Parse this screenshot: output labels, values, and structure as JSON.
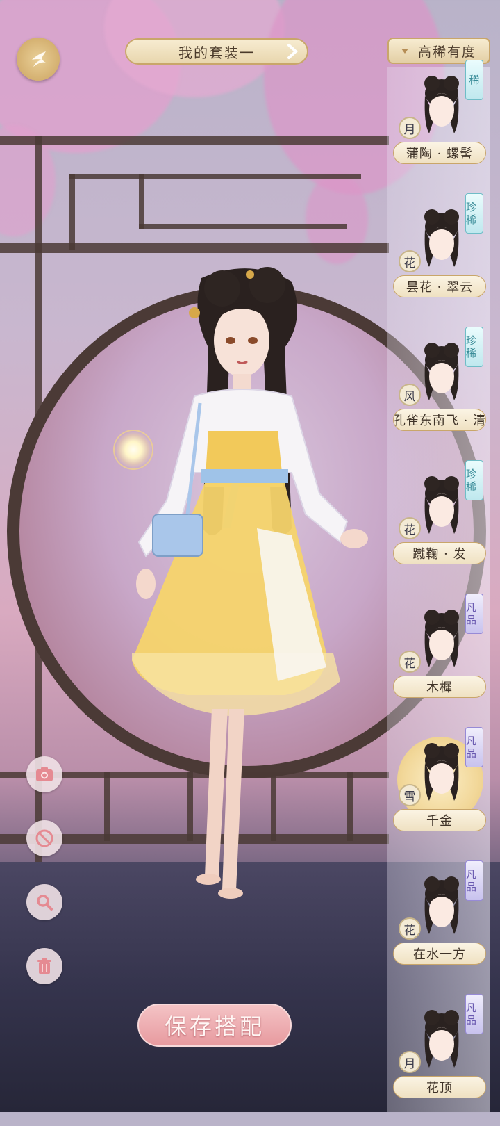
{
  "header": {
    "back_icon": "swallow-back-icon",
    "outfit_name": "我的套装一",
    "sort_label": "高稀有度"
  },
  "items": [
    {
      "name": "蒲陶 · 螺髻",
      "element": "月",
      "rarity": "稀",
      "rarity_tier": "zhen",
      "selected": false
    },
    {
      "name": "昙花 · 翠云",
      "element": "花",
      "rarity": "珍稀",
      "rarity_tier": "zhen",
      "selected": false
    },
    {
      "name": "孔雀东南飞 · 清",
      "element": "风",
      "rarity": "珍稀",
      "rarity_tier": "zhen",
      "selected": false
    },
    {
      "name": "蹴鞠 · 发",
      "element": "花",
      "rarity": "珍稀",
      "rarity_tier": "zhen",
      "selected": false
    },
    {
      "name": "木樨",
      "element": "花",
      "rarity": "凡品",
      "rarity_tier": "feng",
      "selected": false
    },
    {
      "name": "千金",
      "element": "雪",
      "rarity": "凡品",
      "rarity_tier": "feng",
      "selected": true
    },
    {
      "name": "在水一方",
      "element": "花",
      "rarity": "凡品",
      "rarity_tier": "feng",
      "selected": false
    },
    {
      "name": "花顶",
      "element": "月",
      "rarity": "凡品",
      "rarity_tier": "feng",
      "selected": false
    }
  ],
  "tools": [
    "camera-icon",
    "no-entry-icon",
    "magnifier-icon",
    "trash-icon"
  ],
  "save_label": "保存搭配",
  "colors": {
    "accent_gold": "#d4b070",
    "save_pink": "#e79a9f",
    "rarity_zhen": "#3a8c98",
    "rarity_feng": "#6a5ab0"
  }
}
